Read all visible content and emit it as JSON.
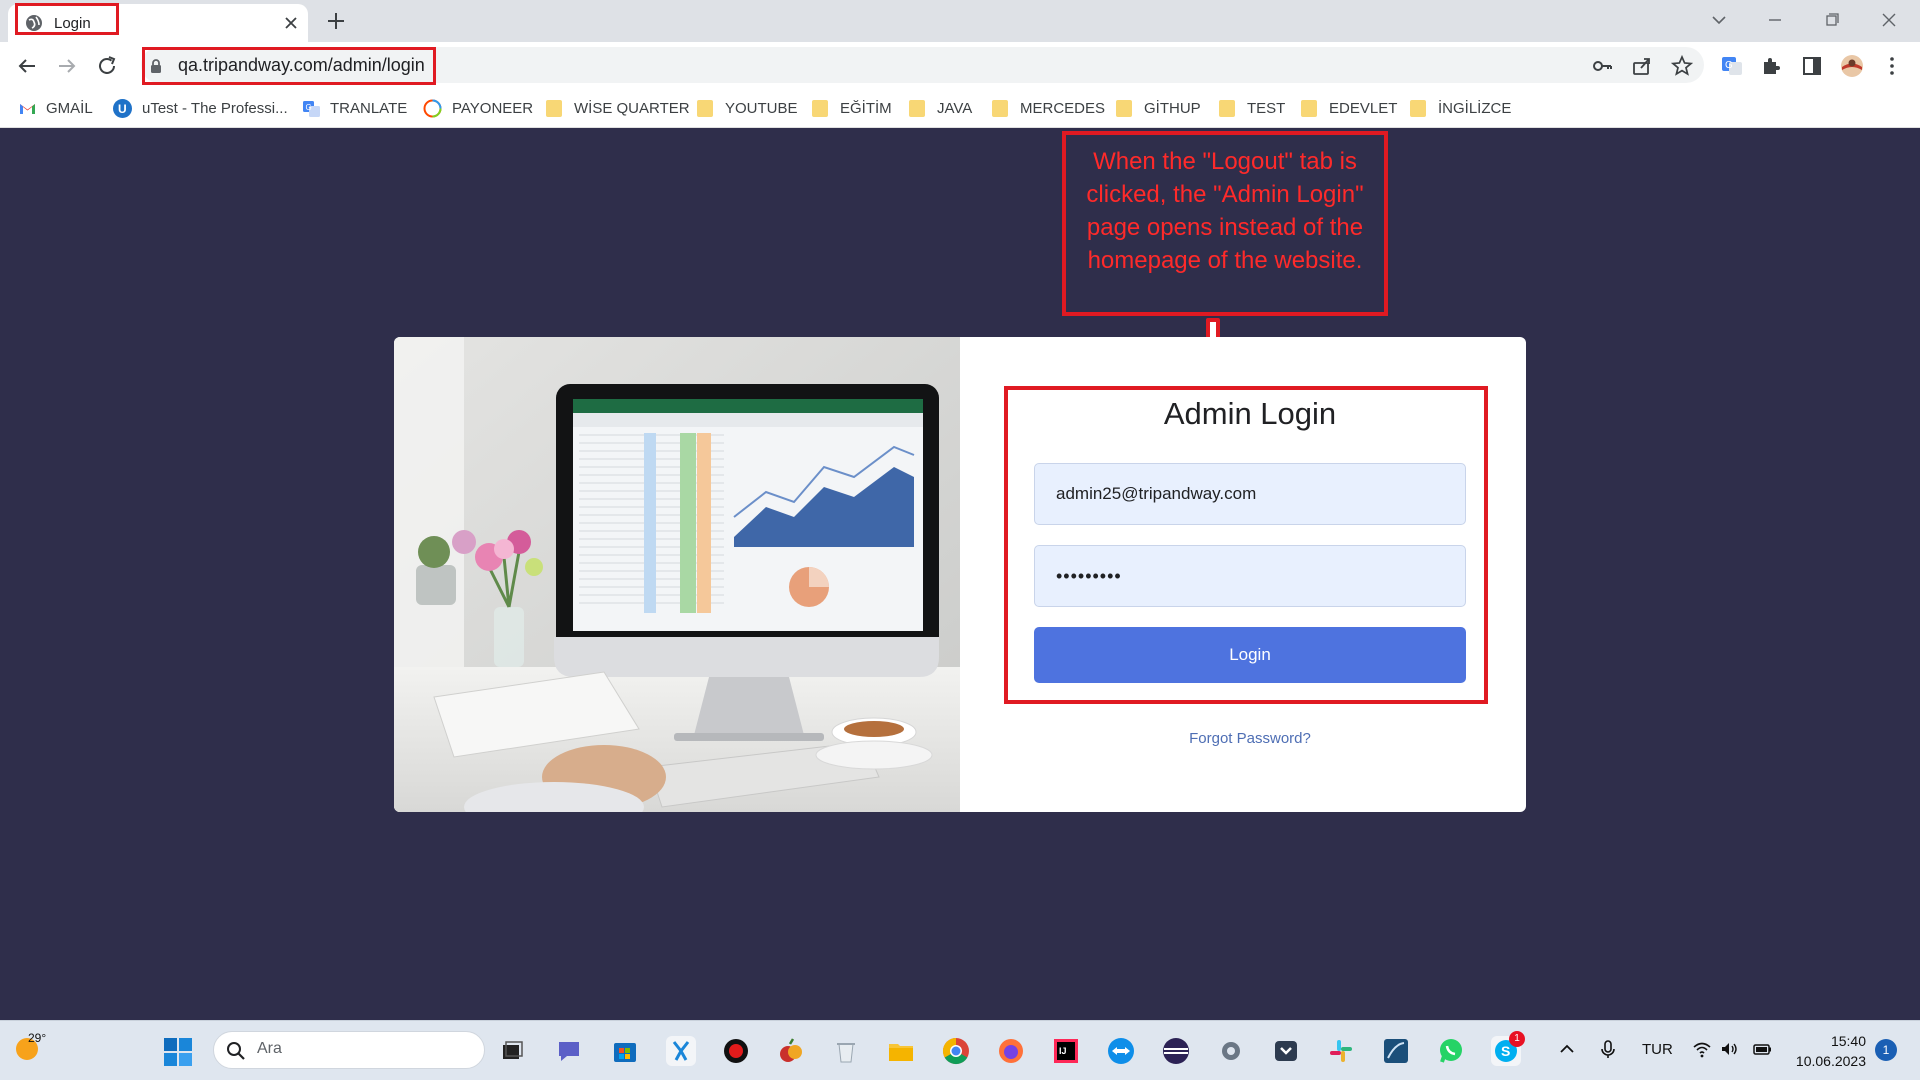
{
  "browser": {
    "tab_title": "Login",
    "url": "qa.tripandway.com/admin/login"
  },
  "bookmarks": [
    {
      "label": "GMAİL",
      "icon": "gmail-icon"
    },
    {
      "label": "uTest - The Professi...",
      "icon": "utest-icon"
    },
    {
      "label": "TRANLATE",
      "icon": "translate-icon"
    },
    {
      "label": "PAYONEER",
      "icon": "payoneer-icon"
    },
    {
      "label": "WİSE QUARTER",
      "icon": "folder-icon"
    },
    {
      "label": "YOUTUBE",
      "icon": "folder-icon"
    },
    {
      "label": "EĞİTİM",
      "icon": "folder-icon"
    },
    {
      "label": "JAVA",
      "icon": "folder-icon"
    },
    {
      "label": "MERCEDES",
      "icon": "folder-icon"
    },
    {
      "label": "GİTHUP",
      "icon": "folder-icon"
    },
    {
      "label": "TEST",
      "icon": "folder-icon"
    },
    {
      "label": "EDEVLET",
      "icon": "folder-icon"
    },
    {
      "label": "İNGİLİZCE",
      "icon": "folder-icon"
    }
  ],
  "annotation": {
    "text": "When the \"Logout\" tab is clicked, the \"Admin Login\" page opens instead of the homepage of the website.",
    "color": "#e01a22"
  },
  "login": {
    "title": "Admin Login",
    "email_value": "admin25@tripandway.com",
    "password_value": "•••••••••",
    "button_label": "Login",
    "forgot_label": "Forgot Password?",
    "accent_color": "#4e73df"
  },
  "taskbar": {
    "weather_temp": "29°",
    "search_placeholder": "Ara",
    "language": "TUR",
    "time": "15:40",
    "date": "10.06.2023",
    "skype_badge": "1",
    "notifications": "1"
  },
  "colors": {
    "page_background": "#2f2e4b",
    "highlight_red": "#e01a22"
  }
}
